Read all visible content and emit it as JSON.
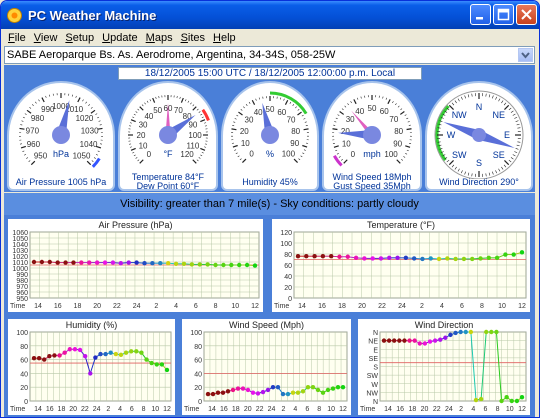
{
  "window": {
    "title": "PC Weather Machine"
  },
  "menu": [
    "File",
    "View",
    "Setup",
    "Update",
    "Maps",
    "Sites",
    "Help"
  ],
  "station": {
    "value": "SABE  Aeroparque Bs. As. Aerodrome, Argentina, 34-34S, 058-25W"
  },
  "time": {
    "label": "18/12/2005 15:00 UTC / 18/12/2005 12:00:00 p.m. Local"
  },
  "gauges": {
    "pressure": {
      "unit": "hPa",
      "label": "Air Pressure  1005 hPa",
      "ticks": [
        "950",
        "960",
        "970",
        "980",
        "990",
        "1000",
        "1010",
        "1020",
        "1030",
        "1040",
        "1050"
      ],
      "value": 1005
    },
    "temperature": {
      "unit": "°F",
      "label1": "Temperature  84°F",
      "label2": "Dew Point  60°F",
      "ticks": [
        "0",
        "10",
        "20",
        "30",
        "40",
        "50",
        "60",
        "70",
        "80",
        "90",
        "100",
        "110",
        "120"
      ],
      "value": 84,
      "dew": 60
    },
    "humidity": {
      "unit": "%",
      "label": "Humidity  45%",
      "ticks": [
        "0",
        "10",
        "20",
        "30",
        "40",
        "50",
        "60",
        "70",
        "80",
        "90",
        "100"
      ],
      "value": 45
    },
    "wind": {
      "unit": "mph",
      "label1": "Wind Speed  18Mph",
      "label2": "Gust Speed  35Mph",
      "ticks": [
        "0",
        "10",
        "20",
        "30",
        "40",
        "50",
        "60",
        "70",
        "80",
        "90",
        "100"
      ],
      "value": 18,
      "gust": 35
    },
    "direction": {
      "label": "Wind Direction   290°",
      "points": [
        "N",
        "NE",
        "E",
        "SE",
        "S",
        "SW",
        "W",
        "NW"
      ],
      "value": 290
    }
  },
  "conditions": {
    "text": "Visibility:  greater than 7 mile(s)  -   Sky conditions:  partly cloudy"
  },
  "colors": {
    "accent": "#4a7fd8",
    "needle": "#5a6fd8",
    "refline": "#e06060"
  },
  "chart_data": [
    {
      "type": "line",
      "title": "Air Pressure (hPa)",
      "xlabel": "Time",
      "x": [
        "14",
        "16",
        "18",
        "20",
        "22",
        "24",
        "2",
        "4",
        "6",
        "8",
        "10",
        "12"
      ],
      "yticks": [
        "950",
        "960",
        "970",
        "980",
        "990",
        "1000",
        "1010",
        "1020",
        "1030",
        "1040",
        "1050",
        "1060"
      ],
      "ylim": [
        950,
        1060
      ],
      "ref": 1005,
      "values": [
        1010,
        1010,
        1010,
        1009,
        1009,
        1009,
        1009,
        1009,
        1009,
        1009,
        1009,
        1008,
        1009,
        1009,
        1008,
        1008,
        1008,
        1008,
        1007,
        1007,
        1006,
        1006,
        1006,
        1005,
        1005,
        1005,
        1005,
        1005,
        1004
      ]
    },
    {
      "type": "line",
      "title": "Temperature (°F)",
      "xlabel": "Time",
      "x": [
        "14",
        "16",
        "18",
        "20",
        "22",
        "24",
        "2",
        "4",
        "6",
        "8",
        "10",
        "12"
      ],
      "yticks": [
        "0",
        "20",
        "40",
        "60",
        "80",
        "100",
        "120"
      ],
      "ylim": [
        0,
        120
      ],
      "ref": 70,
      "values": [
        76,
        76,
        76,
        76,
        76,
        75,
        75,
        73,
        72,
        72,
        72,
        73,
        73,
        73,
        72,
        71,
        72,
        71,
        72,
        71,
        71,
        71,
        72,
        73,
        73,
        79,
        79,
        83
      ]
    },
    {
      "type": "line",
      "title": "Humidity (%)",
      "xlabel": "Time",
      "x": [
        "14",
        "16",
        "18",
        "20",
        "22",
        "24",
        "2",
        "4",
        "6",
        "8",
        "10",
        "12"
      ],
      "yticks": [
        "0",
        "20",
        "40",
        "60",
        "80",
        "100"
      ],
      "ylim": [
        0,
        100
      ],
      "ref": 55,
      "values": [
        62,
        62,
        60,
        65,
        66,
        66,
        70,
        75,
        75,
        74,
        65,
        40,
        63,
        68,
        68,
        70,
        68,
        67,
        70,
        72,
        72,
        70,
        60,
        55,
        53,
        53,
        45
      ]
    },
    {
      "type": "line",
      "title": "Wind Speed (Mph)",
      "xlabel": "Time",
      "x": [
        "14",
        "16",
        "18",
        "20",
        "22",
        "24",
        "2",
        "4",
        "6",
        "8",
        "10",
        "12"
      ],
      "yticks": [
        "0",
        "20",
        "40",
        "60",
        "80",
        "100"
      ],
      "ylim": [
        0,
        100
      ],
      "ref": 40,
      "values": [
        10,
        10,
        12,
        12,
        14,
        16,
        18,
        18,
        16,
        12,
        11,
        13,
        16,
        20,
        20,
        10,
        10,
        12,
        12,
        14,
        20,
        20,
        16,
        12,
        16,
        18,
        20,
        20
      ]
    },
    {
      "type": "line",
      "title": "Wind Direction",
      "xlabel": "Time",
      "x": [
        "14",
        "16",
        "18",
        "20",
        "22",
        "24",
        "2",
        "4",
        "6",
        "8",
        "10",
        "12"
      ],
      "yticks": [
        "N",
        "NW",
        "W",
        "SW",
        "S",
        "SE",
        "E",
        "NE",
        "N"
      ],
      "ylim": [
        0,
        360
      ],
      "ref": 200,
      "values": [
        315,
        315,
        315,
        315,
        315,
        315,
        315,
        300,
        300,
        310,
        315,
        320,
        330,
        345,
        355,
        360,
        360,
        360,
        5,
        10,
        360,
        360,
        360,
        0,
        20,
        0,
        0,
        20
      ]
    }
  ]
}
